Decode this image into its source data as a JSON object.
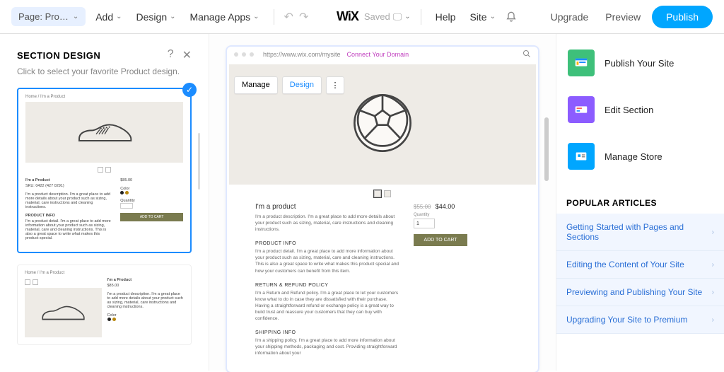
{
  "topbar": {
    "page_label": "Page: Pro…",
    "add": "Add",
    "design": "Design",
    "manage_apps": "Manage Apps",
    "saved": "Saved",
    "help": "Help",
    "site": "Site",
    "upgrade": "Upgrade",
    "preview": "Preview",
    "publish": "Publish",
    "logo": "WiX"
  },
  "left": {
    "title": "SECTION DESIGN",
    "subtitle": "Click to select your favorite Product design.",
    "card1": {
      "crumb": "Home / I'm a Product",
      "name": "I'm a Product",
      "sku": "SKU: 0422 (427 0291)",
      "desc": "I'm a product description. I'm a great place to add more details about your product such as sizing, material, care instructions and cleaning instructions.",
      "sec1": "PRODUCT INFO",
      "sec1_body": "I'm a product detail. I'm a great place to add more information about your product such as sizing, material, care and cleaning instructions. This is also a great space to write what makes this product special.",
      "price": "$85.00",
      "color_label": "Color",
      "qty_label": "Quantity",
      "addcart": "ADD TO CART"
    }
  },
  "stage": {
    "url": "https://www.wix.com/mysite",
    "connect_domain": "Connect Your Domain",
    "toolbar": {
      "manage": "Manage",
      "design": "Design"
    },
    "title": "I'm a product",
    "desc": "I'm a product description. I'm a great place to add more details about your product such as sizing, material, care instructions and cleaning instructions.",
    "sections": {
      "info_head": "PRODUCT INFO",
      "info_body": "I'm a product detail. I'm a great place to add more information about your product such as sizing, material, care and cleaning instructions. This is also a great space to write what makes this product special and how your customers can benefit from this item.",
      "return_head": "RETURN & REFUND POLICY",
      "return_body": "I'm a Return and Refund policy. I'm a great place to let your customers know what to do in case they are dissatisfied with their purchase. Having a straightforward refund or exchange policy is a great way to build trust and reassure your customers that they can buy with confidence.",
      "ship_head": "SHIPPING INFO",
      "ship_body": "I'm a shipping policy. I'm a great place to add more information about your shipping methods, packaging and cost. Providing straightforward information about your"
    },
    "price_old": "$55.00",
    "price_new": "$44.00",
    "qty_label": "Quantity",
    "qty_value": "1",
    "addcart": "ADD TO CART"
  },
  "right": {
    "cards": {
      "publish_site": "Publish Your Site",
      "edit_section": "Edit Section",
      "manage_store": "Manage Store"
    },
    "articles_head": "POPULAR ARTICLES",
    "links": {
      "a": "Getting Started with Pages and Sections",
      "b": "Editing the Content of Your Site",
      "c": "Previewing and Publishing Your Site",
      "d": "Upgrading Your Site to Premium"
    }
  }
}
